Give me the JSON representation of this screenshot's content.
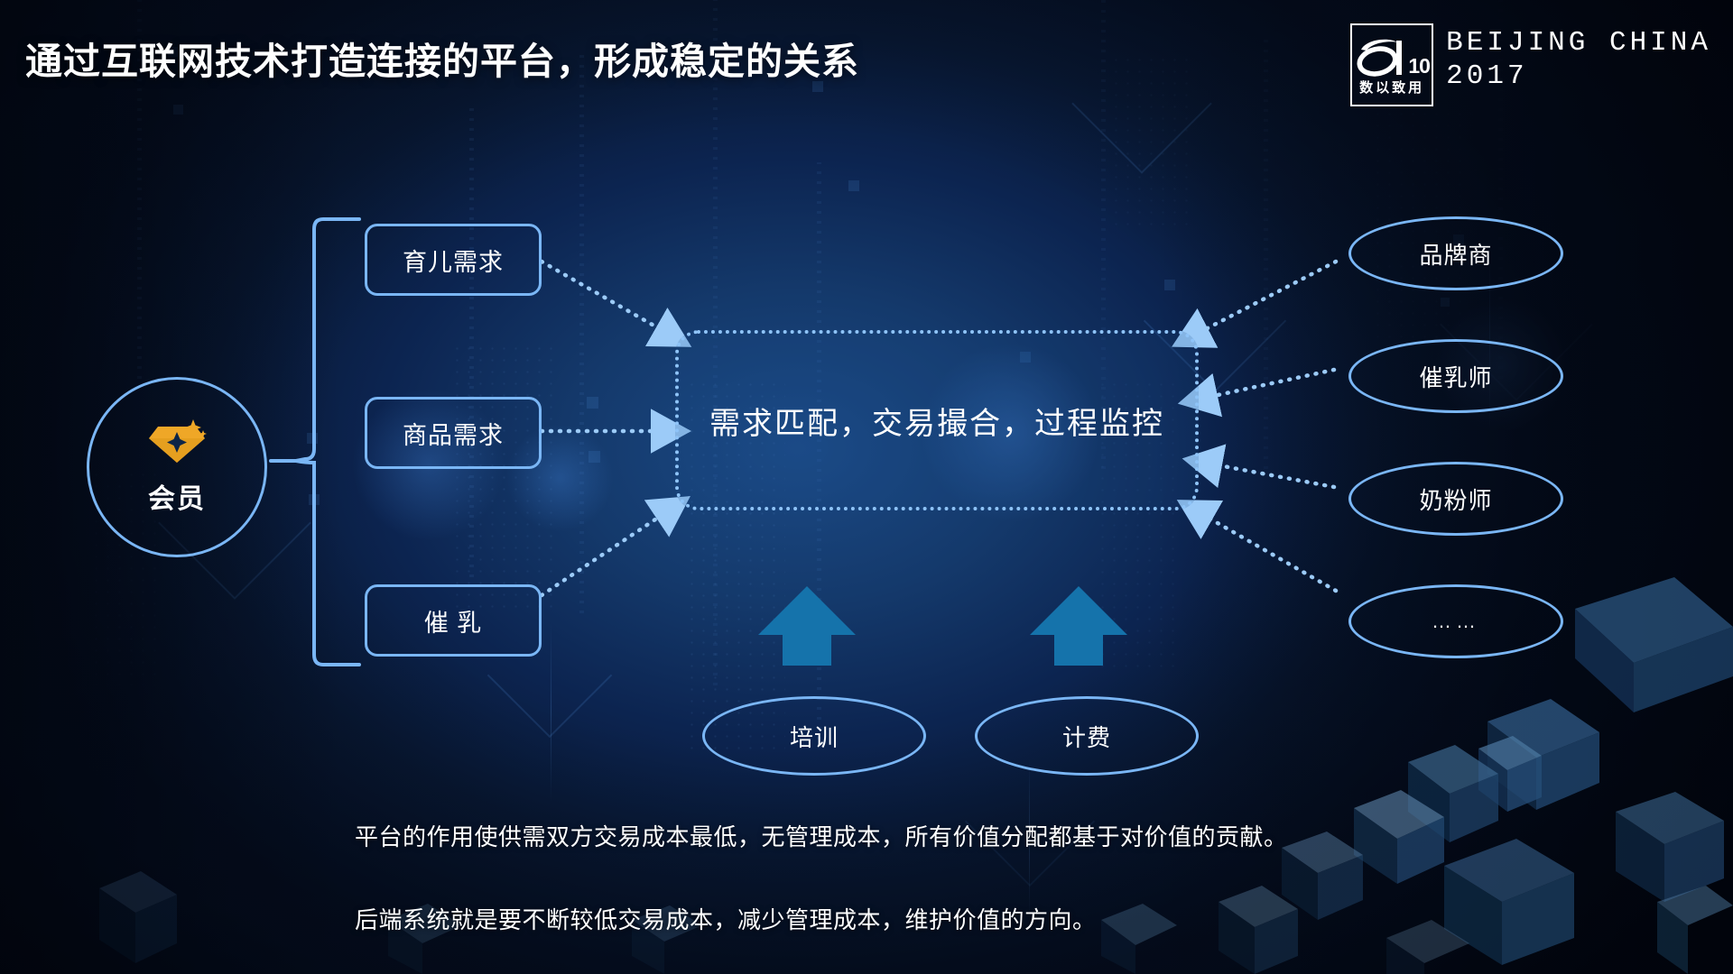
{
  "header": {
    "title": "通过互联网技术打造连接的平台，形成稳定的关系",
    "brand": {
      "mark_number": "10",
      "mark_slogan": "数以致用",
      "city": "BEIJING CHINA",
      "year": "2017"
    }
  },
  "diagram": {
    "member": {
      "label": "会员",
      "icon": "diamond-gem-icon"
    },
    "demand_boxes": [
      {
        "label": "育儿需求"
      },
      {
        "label": "商品需求"
      },
      {
        "label": "催 乳"
      }
    ],
    "center": {
      "label": "需求匹配，交易撮合，过程监控"
    },
    "providers": [
      {
        "label": "品牌商"
      },
      {
        "label": "催乳师"
      },
      {
        "label": "奶粉师"
      },
      {
        "label": "……"
      }
    ],
    "services": [
      {
        "label": "培训"
      },
      {
        "label": "计费"
      }
    ]
  },
  "captions": [
    "平台的作用使供需双方交易成本最低，无管理成本，所有价值分配都基于对价值的贡献。",
    "后端系统就是要不断较低交易成本，减少管理成本，维护价值的方向。"
  ],
  "colors": {
    "accent_line": "#7ab6f5",
    "gem_gold": "#efa727",
    "arrow_blue": "#1573ab",
    "text_white": "#ffffff",
    "background_deep": "#071228"
  }
}
